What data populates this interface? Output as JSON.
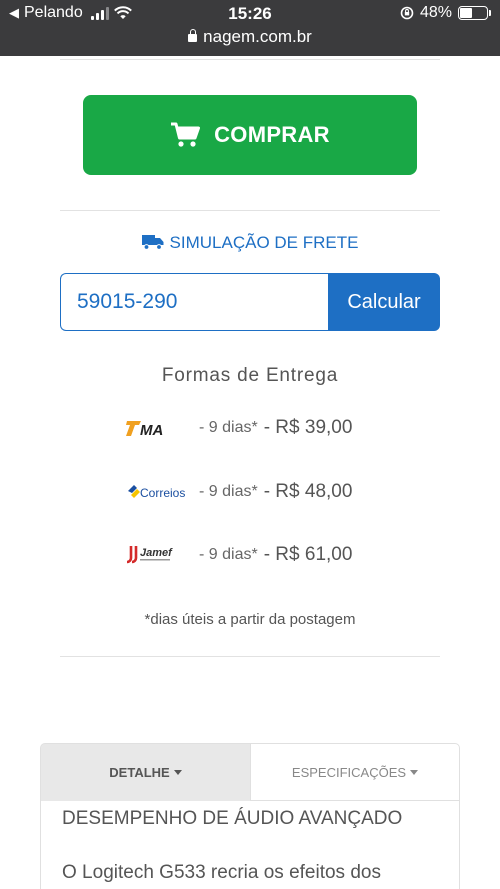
{
  "status_bar": {
    "carrier": "Pelando",
    "time": "15:26",
    "battery": "48%",
    "battery_level": 0.48,
    "url": "nagem.com.br"
  },
  "buy_button": {
    "label": "COMPRAR",
    "icon": "cart-icon"
  },
  "freight": {
    "title": "SIMULAÇÃO DE FRETE",
    "icon": "truck-icon",
    "cep_value": "59015-290",
    "calc_label": "Calcular"
  },
  "delivery": {
    "title": "Formas de Entrega",
    "options": [
      {
        "carrier": "TMA",
        "days": "- 9 dias*",
        "price": "- R$ 39,00"
      },
      {
        "carrier": "Correios",
        "days": "- 9 dias*",
        "price": "- R$ 48,00"
      },
      {
        "carrier": "Jamef",
        "days": "- 9 dias*",
        "price": "- R$ 61,00"
      }
    ],
    "note": "*dias úteis a partir da postagem"
  },
  "tabs": [
    {
      "label": "DETALHE",
      "active": true
    },
    {
      "label": "ESPECIFICAÇÕES",
      "active": false
    }
  ],
  "description": {
    "heading": "DESEMPENHO DE ÁUDIO AVANÇADO",
    "text": "O Logitech G533 recria os efeitos dos"
  },
  "colors": {
    "buy_green": "#19a846",
    "brand_blue": "#1e6fc4",
    "status_bar": "#3b3b3d"
  }
}
